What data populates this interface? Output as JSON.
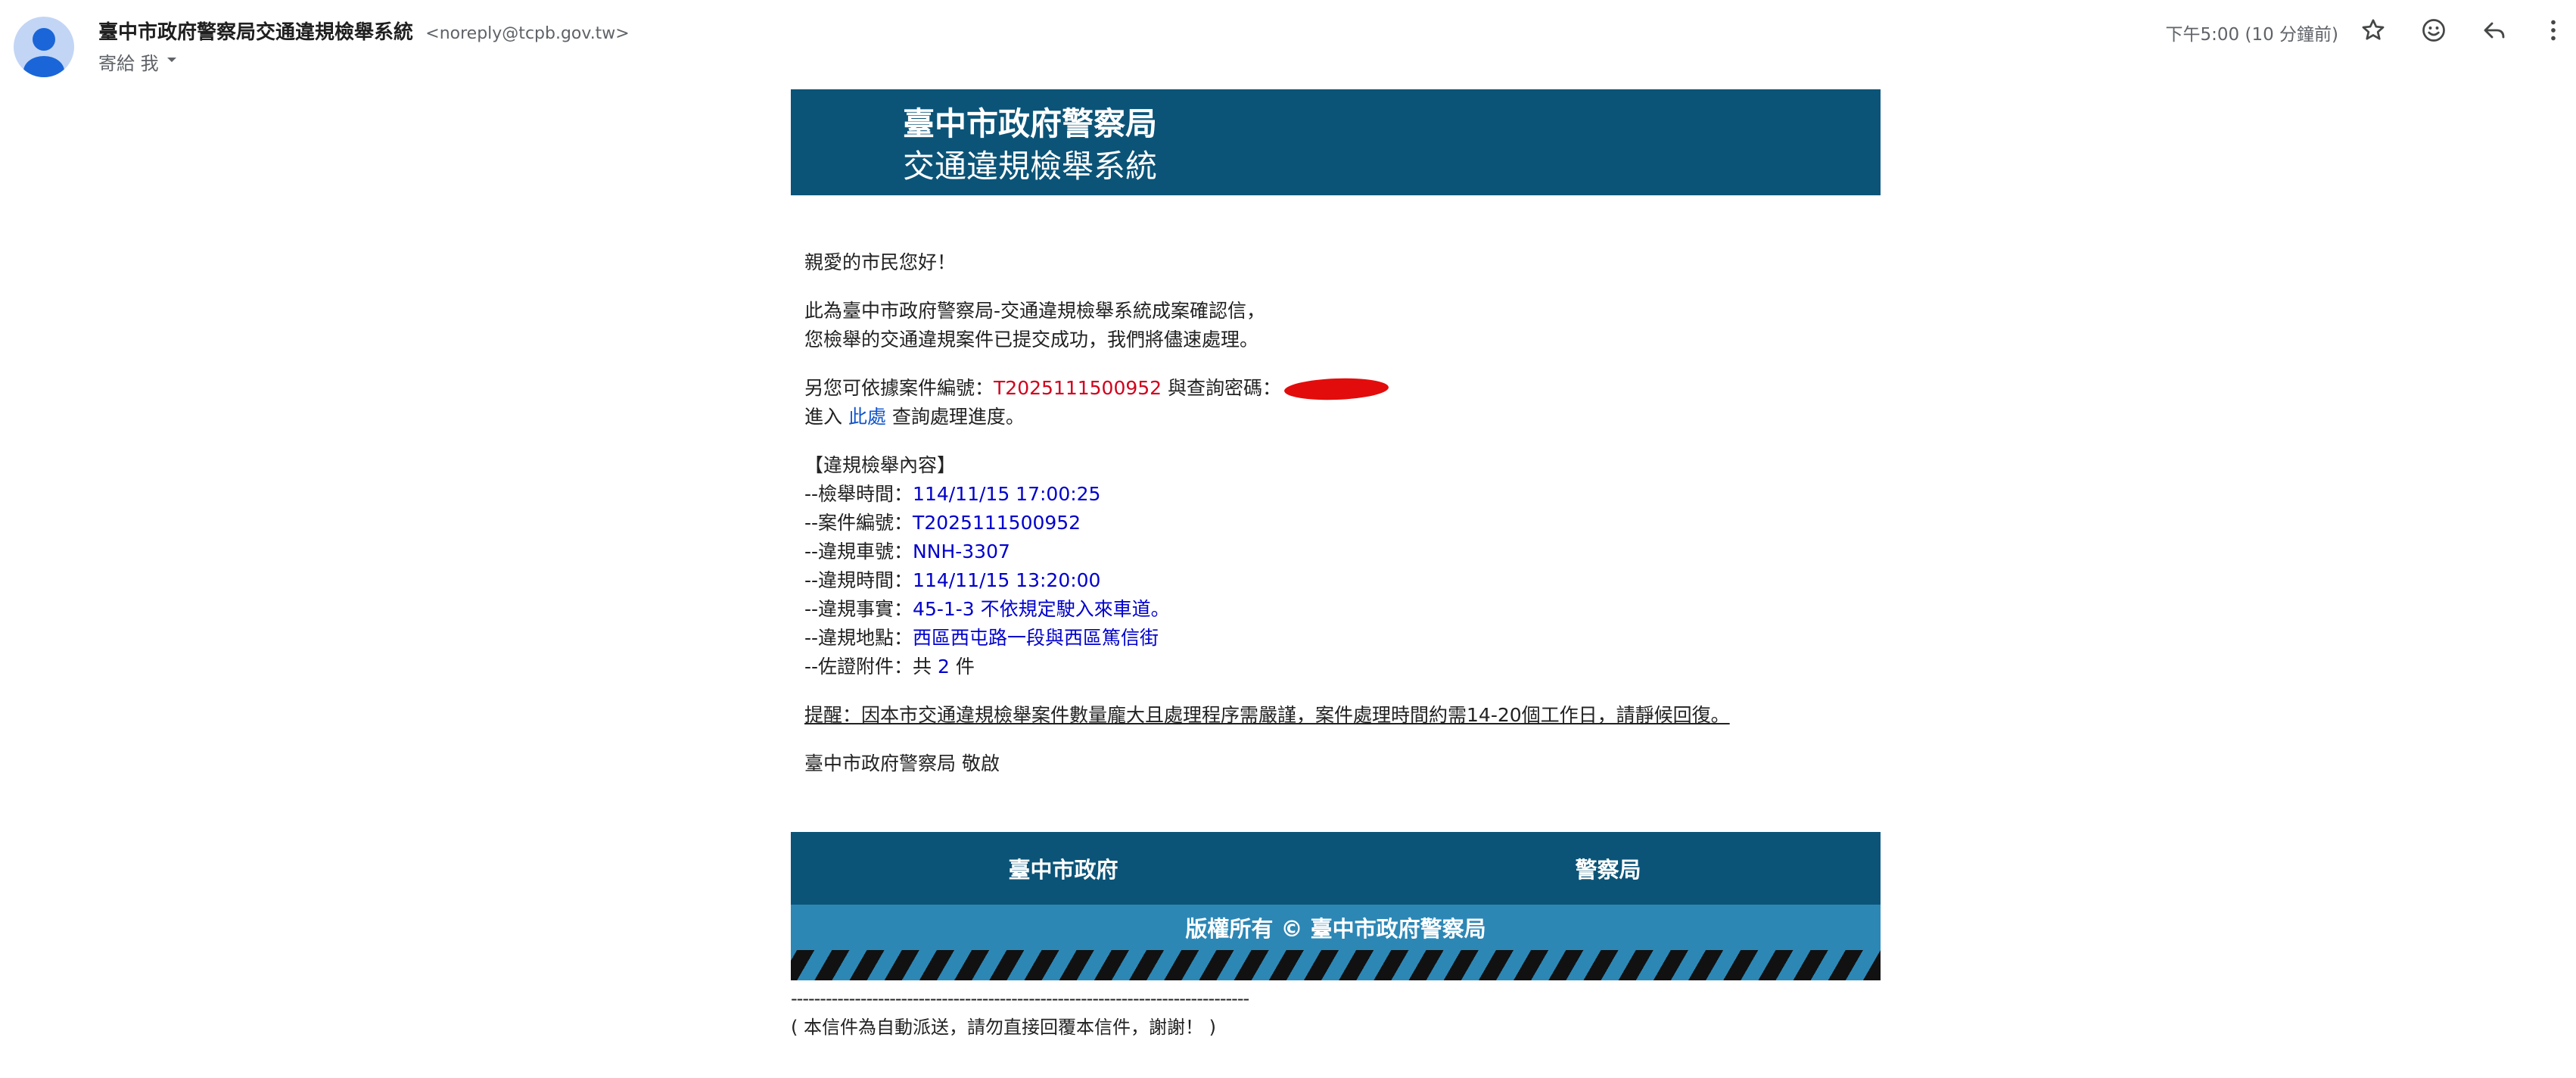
{
  "header": {
    "sender_name": "臺中市政府警察局交通違規檢舉系統",
    "sender_email": "<noreply@tcpb.gov.tw>",
    "to_label": "寄給 我",
    "time": "下午5:00 (10 分鐘前)",
    "icons": [
      "avatar",
      "star-icon",
      "emoji-icon",
      "reply-icon",
      "more-vert-icon",
      "chevron-down-icon"
    ]
  },
  "banner": {
    "line1": "臺中市政府警察局",
    "line2": "交通違規檢舉系統"
  },
  "body": {
    "greeting": "親愛的市民您好！",
    "confirm_line1": "此為臺中市政府警察局-交通違規檢舉系統成案確認信，",
    "confirm_line2": "您檢舉的交通違規案件已提交成功，我們將儘速處理。",
    "query_prefix": "另您可依據案件編號：",
    "case_number": "T2025111500952",
    "query_middle": " 與查詢密碼：",
    "enter_prefix": "進入 ",
    "link_text": "此處",
    "enter_suffix": " 查詢處理進度。",
    "section_title": "【違規檢舉內容】",
    "details": [
      {
        "label": "--檢舉時間：",
        "value": "114/11/15 17:00:25"
      },
      {
        "label": "--案件編號：",
        "value": "T2025111500952"
      },
      {
        "label": "--違規車號：",
        "value": "NNH-3307"
      },
      {
        "label": "--違規時間：",
        "value": "114/11/15 13:20:00"
      },
      {
        "label": "--違規事實：",
        "value": "45-1-3 不依規定駛入來車道。"
      },
      {
        "label": "--違規地點：",
        "value": "西區西屯路一段與西區篤信街"
      }
    ],
    "attach_label": "--佐證附件：",
    "attach_prefix": "共 ",
    "attach_count": "2",
    "attach_suffix": " 件",
    "reminder": "提醒：因本市交通違規檢舉案件數量龐大且處理程序需嚴謹，案件處理時間約需14-20個工作日，請靜候回復。",
    "signoff": "臺中市政府警察局 敬啟"
  },
  "footer": {
    "link_left": "臺中市政府",
    "link_right": "警察局",
    "copyright": "版權所有 © 臺中市政府警察局",
    "dashes": "-------------------------------------------------------------------------------",
    "auto_note": "( 本信件為自動派送，請勿直接回覆本信件，謝謝！ )"
  },
  "colors": {
    "banner_bg": "#0b5478",
    "copyright_bg": "#2c87b5",
    "case_number": "#d0021b",
    "detail_value": "#0000cc",
    "link": "#1155cc"
  }
}
